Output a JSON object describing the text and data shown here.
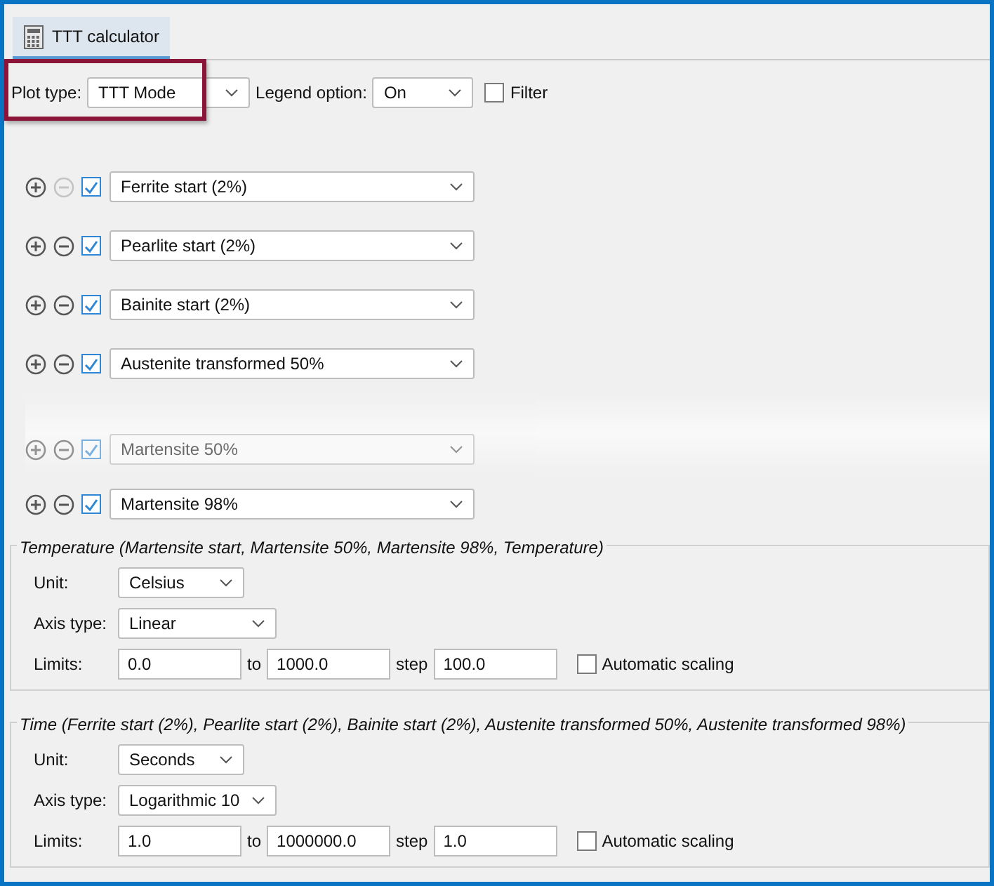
{
  "tab": {
    "label": "TTT calculator",
    "selected": true
  },
  "toolbar": {
    "plot_type_label": "Plot type:",
    "plot_type": "TTT Mode",
    "legend_label": "Legend option:",
    "legend": "On",
    "filter": {
      "label": "Filter",
      "checked": false
    }
  },
  "curves": [
    {
      "name": "Ferrite start (2%)",
      "checked": true,
      "remove_disabled": true,
      "faded": false
    },
    {
      "name": "Pearlite start (2%)",
      "checked": true,
      "remove_disabled": false,
      "faded": false
    },
    {
      "name": "Bainite start (2%)",
      "checked": true,
      "remove_disabled": false,
      "faded": false
    },
    {
      "name": "Austenite transformed 50%",
      "checked": true,
      "remove_disabled": false,
      "faded": false
    },
    {
      "name": "Martensite 50%",
      "checked": true,
      "remove_disabled": false,
      "faded": true
    },
    {
      "name": "Martensite 98%",
      "checked": true,
      "remove_disabled": false,
      "faded": false
    }
  ],
  "axes": [
    {
      "title": "Temperature (Martensite start, Martensite 50%, Martensite 98%, Temperature)",
      "unit_label": "Unit:",
      "unit": "Celsius",
      "axis_type_label": "Axis type:",
      "axis_type": "Linear",
      "limits_label": "Limits:",
      "min": "0.0",
      "to_label": "to",
      "max": "1000.0",
      "step_label": "step",
      "step": "100.0",
      "auto": {
        "label": "Automatic scaling",
        "checked": false
      }
    },
    {
      "title": "Time (Ferrite start (2%), Pearlite start (2%), Bainite start (2%), Austenite transformed 50%, Austenite transformed 98%)",
      "unit_label": "Unit:",
      "unit": "Seconds",
      "axis_type_label": "Axis type:",
      "axis_type": "Logarithmic 10",
      "limits_label": "Limits:",
      "min": "1.0",
      "to_label": "to",
      "max": "1000000.0",
      "step_label": "step",
      "step": "1.0",
      "auto": {
        "label": "Automatic scaling",
        "checked": false
      }
    }
  ]
}
